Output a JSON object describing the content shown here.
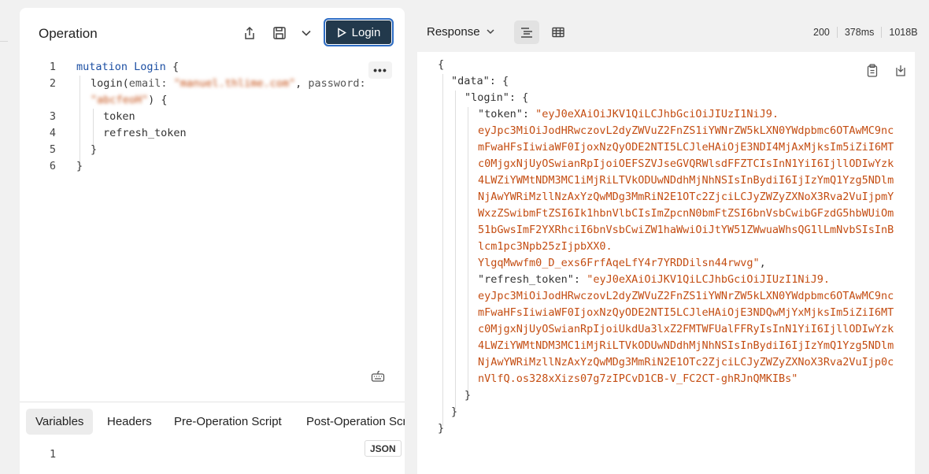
{
  "operation": {
    "title": "Operation",
    "run_button_label": "Login",
    "code": {
      "line_numbers": [
        "1",
        "2",
        "3",
        "4",
        "5",
        "6"
      ],
      "kw_mutation": "mutation",
      "op_name": "Login",
      "open_brace": "{",
      "field_login": "login",
      "arg_email": "email:",
      "email_value": "\"manuel.thlime.com\"",
      "arg_password": "password:",
      "password_value": "\"abcfeoH\"",
      "close_args": ") {",
      "open_paren": "(",
      "comma": ",",
      "field_token": "token",
      "field_refresh": "refresh_token",
      "close_inner": "}",
      "close_outer": "}"
    }
  },
  "bottom_tabs": [
    "Variables",
    "Headers",
    "Pre-Operation Script",
    "Post-Operation Script"
  ],
  "variables": {
    "line_number": "1",
    "format_badge": "JSON"
  },
  "response": {
    "title": "Response",
    "status": "200",
    "time": "378ms",
    "size": "1018B",
    "json": {
      "open": "{",
      "data_key": "\"data\"",
      "login_key": "\"login\"",
      "token_key": "\"token\"",
      "token_lines": [
        "\"eyJ0eXAiOiJKV1QiLCJhbGciOiJIUzI1NiJ9.",
        "eyJpc3MiOiJodHRwczovL2dyZWVuZ2FnZS1iYWNrZW5kLXN0YWdpbmc6OTAwMC9nc",
        "mFwaHFsIiwiaWF0IjoxNzQyODE2NTI5LCJleHAiOjE3NDI4MjAxMjksIm5iZiI6MT",
        "c0MjgxNjUyOSwianRpIjoiOEFSZVJseGVQRWlsdFFZTCIsInN1YiI6IjllODIwYzk",
        "4LWZiYWMtNDM3MC1iMjRiLTVkODUwNDdhMjNhNSIsInBydiI6IjIzYmQ1Yzg5NDlm",
        "NjAwYWRiMzllNzAxYzQwMDg3MmRiN2E1OTc2ZjciLCJyZWZyZXNoX3Rva2VuIjpmY",
        "WxzZSwibmFtZSI6Ik1hbnVlbCIsImZpcnN0bmFtZSI6bnVsbCwibGFzdG5hbWUiOm",
        "51bGwsImF2YXRhciI6bnVsbCwiZW1haWwiOiJtYW51ZWwuaWhsQG1lLmNvbSIsInB",
        "lcm1pc3Npb25zIjpbXX0.",
        "YlgqMwwfm0_D_exs6FrfAqeLfY4r7YRDDilsn44rwvg\""
      ],
      "refresh_key": "\"refresh_token\"",
      "refresh_lines": [
        "\"eyJ0eXAiOiJKV1QiLCJhbGciOiJIUzI1NiJ9.",
        "eyJpc3MiOiJodHRwczovL2dyZWVuZ2FnZS1iYWNrZW5kLXN0YWdpbmc6OTAwMC9nc",
        "mFwaHFsIiwiaWF0IjoxNzQyODE2NTI5LCJleHAiOjE3NDQwMjYxMjksIm5iZiI6MT",
        "c0MjgxNjUyOSwianRpIjoiUkdUa3lxZ2FMTWFUalFFRyIsInN1YiI6IjllODIwYzk",
        "4LWZiYWMtNDM3MC1iMjRiLTVkODUwNDdhMjNhNSIsInBydiI6IjIzYmQ1Yzg5NDlm",
        "NjAwYWRiMzllNzAxYzQwMDg3MmRiN2E1OTc2ZjciLCJyZWZyZXNoX3Rva2VuIjp0c",
        "nVlfQ.os328xXizs07g7zIPCvD1CB-V_FC2CT-ghRJnQMKIBs\""
      ],
      "close_login": "}",
      "close_data": "}",
      "close_root": "}"
    }
  },
  "icons": {
    "share": "share-icon",
    "save": "save-icon",
    "chevron": "chevron-down-icon",
    "play": "play-icon",
    "more": "more-icon",
    "keyboard": "keyboard-icon",
    "text_view": "text-view-icon",
    "table_view": "table-view-icon",
    "copy": "copy-icon",
    "download": "download-icon"
  }
}
